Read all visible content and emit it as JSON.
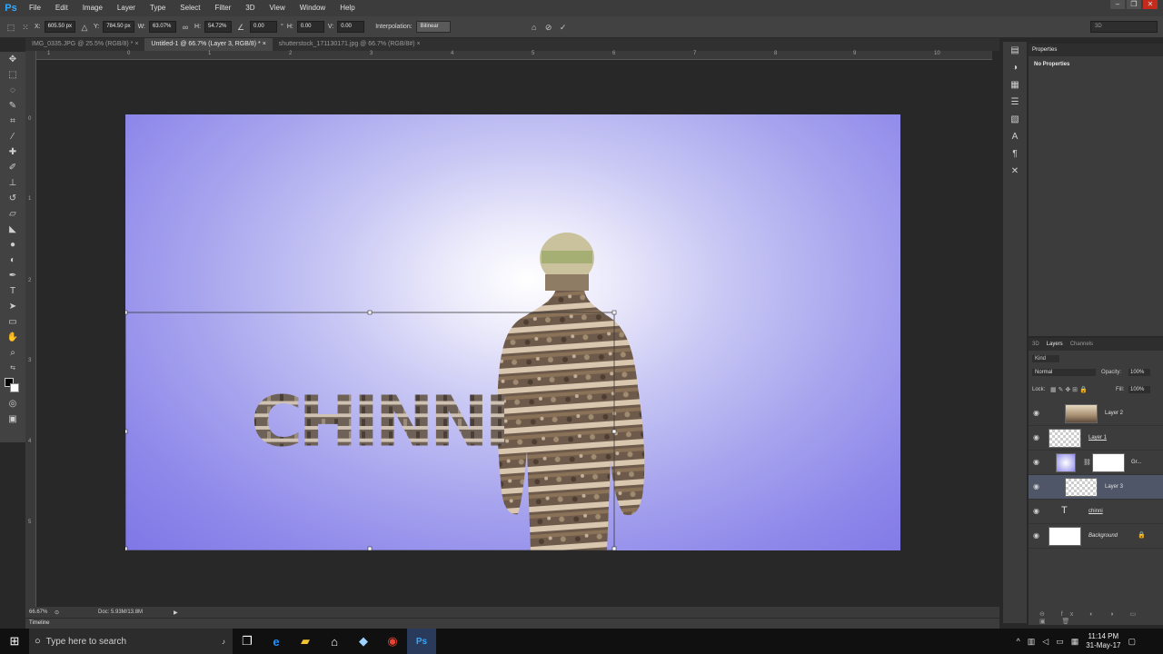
{
  "app": {
    "logo": "Ps"
  },
  "menu": [
    "File",
    "Edit",
    "Image",
    "Layer",
    "Type",
    "Select",
    "Filter",
    "3D",
    "View",
    "Window",
    "Help"
  ],
  "options": {
    "x_label": "X:",
    "x_value": "605.50 px",
    "y_label": "Y:",
    "y_value": "784.50 px",
    "w_label": "W:",
    "w_value": "63.07%",
    "h_label": "H:",
    "h_value": "54.72%",
    "angle_value": "0.00",
    "angle_unit": "°",
    "hskew_label": "H:",
    "hskew_value": "0.00",
    "vskew_label": "V:",
    "vskew_value": "0.00",
    "interp_label": "Interpolation:",
    "interp_value": "Bilinear",
    "workspace": "3D"
  },
  "tabs": [
    "IMG_0335.JPG @ 25.5% (RGB/8) *",
    "Untitled-1 @ 66.7% (Layer 3, RGB/8) *",
    "shutterstock_171130171.jpg @ 66.7% (RGB/8#)"
  ],
  "ruler": {
    "h": [
      "1",
      "0",
      "1",
      "2",
      "3",
      "4",
      "5",
      "6",
      "7",
      "8",
      "9",
      "10"
    ],
    "v": [
      "0",
      "1",
      "2",
      "3",
      "4",
      "5"
    ]
  },
  "canvas": {
    "text": "CHINNI"
  },
  "status": {
    "zoom": "66.67%",
    "doc": "Doc: 5.93M/13.8M"
  },
  "timeline_label": "Timeline",
  "properties": {
    "tab": "Properties",
    "message": "No Properties"
  },
  "layers_panel": {
    "tabs": [
      "3D",
      "Layers",
      "Channels"
    ],
    "kind": "Kind",
    "blend": "Normal",
    "opacity_label": "Opacity:",
    "opacity": "100%",
    "lock_label": "Lock:",
    "fill_label": "Fill:",
    "fill": "100%",
    "layers": [
      "Layer 2",
      "Layer 1",
      "Gr...",
      "Layer 3",
      "chinni",
      "Background"
    ]
  },
  "taskbar": {
    "search": "Type here to search",
    "time": "11:14 PM",
    "date": "31-May-17"
  }
}
